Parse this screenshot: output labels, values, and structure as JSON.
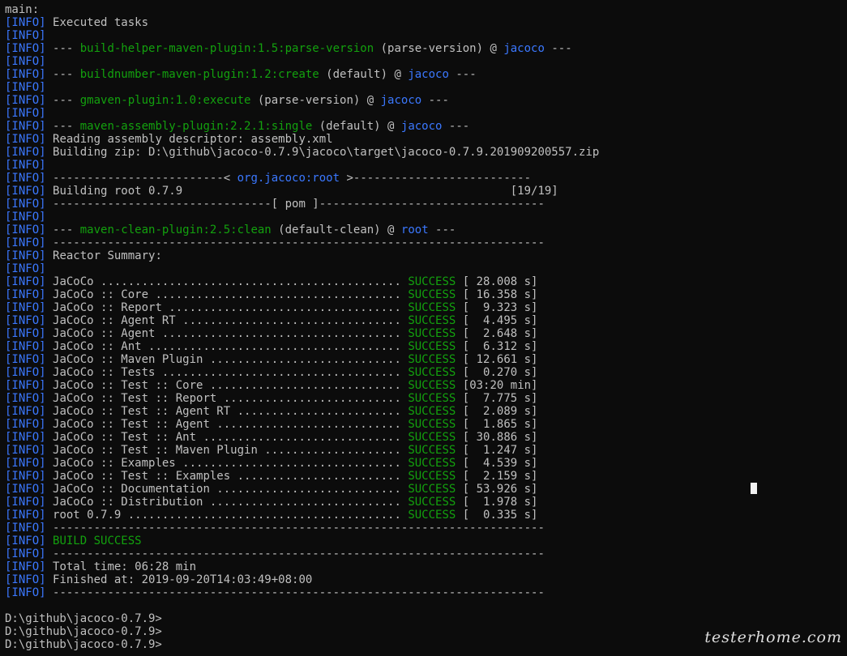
{
  "terminal": {
    "first_line": "main:",
    "info_tag": "[INFO]",
    "executed": "Executed tasks",
    "plugins": [
      {
        "prefix": "--- ",
        "name": "build-helper-maven-plugin:1.5:parse-version",
        "goal": " (parse-version) @ ",
        "project": "jacoco",
        "suffix": " ---"
      },
      {
        "prefix": "--- ",
        "name": "buildnumber-maven-plugin:1.2:create",
        "goal": " (default) @ ",
        "project": "jacoco",
        "suffix": " ---"
      },
      {
        "prefix": "--- ",
        "name": "gmaven-plugin:1.0:execute",
        "goal": " (parse-version) @ ",
        "project": "jacoco",
        "suffix": " ---"
      },
      {
        "prefix": "--- ",
        "name": "maven-assembly-plugin:2.2.1:single",
        "goal": " (default) @ ",
        "project": "jacoco",
        "suffix": " ---"
      }
    ],
    "reading": "Reading assembly descriptor: assembly.xml",
    "building_zip": "Building zip: D:\\github\\jacoco-0.7.9\\jacoco\\target\\jacoco-0.7.9.201909200557.zip",
    "root_header_left": "-------------------------< ",
    "root_header_id": "org.jacoco:root",
    "root_header_right": " >--------------------------",
    "building_root": "Building root 0.7.9                                                [19/19]",
    "pom_line": "--------------------------------[ pom ]---------------------------------",
    "clean_plugin": {
      "prefix": "--- ",
      "name": "maven-clean-plugin:2.5:clean",
      "goal": " (default-clean) @ ",
      "project": "root",
      "suffix": " ---"
    },
    "separator": "------------------------------------------------------------------------",
    "reactor_summary": "Reactor Summary:",
    "reactor_items": [
      {
        "label": "JaCoCo ............................................",
        "status": "SUCCESS",
        "time": " [ 28.008 s]"
      },
      {
        "label": "JaCoCo :: Core ....................................",
        "status": "SUCCESS",
        "time": " [ 16.358 s]"
      },
      {
        "label": "JaCoCo :: Report ..................................",
        "status": "SUCCESS",
        "time": " [  9.323 s]"
      },
      {
        "label": "JaCoCo :: Agent RT ................................",
        "status": "SUCCESS",
        "time": " [  4.495 s]"
      },
      {
        "label": "JaCoCo :: Agent ...................................",
        "status": "SUCCESS",
        "time": " [  2.648 s]"
      },
      {
        "label": "JaCoCo :: Ant .....................................",
        "status": "SUCCESS",
        "time": " [  6.312 s]"
      },
      {
        "label": "JaCoCo :: Maven Plugin ............................",
        "status": "SUCCESS",
        "time": " [ 12.661 s]"
      },
      {
        "label": "JaCoCo :: Tests ...................................",
        "status": "SUCCESS",
        "time": " [  0.270 s]"
      },
      {
        "label": "JaCoCo :: Test :: Core ............................",
        "status": "SUCCESS",
        "time": " [03:20 min]"
      },
      {
        "label": "JaCoCo :: Test :: Report ..........................",
        "status": "SUCCESS",
        "time": " [  7.775 s]"
      },
      {
        "label": "JaCoCo :: Test :: Agent RT ........................",
        "status": "SUCCESS",
        "time": " [  2.089 s]"
      },
      {
        "label": "JaCoCo :: Test :: Agent ...........................",
        "status": "SUCCESS",
        "time": " [  1.865 s]"
      },
      {
        "label": "JaCoCo :: Test :: Ant .............................",
        "status": "SUCCESS",
        "time": " [ 30.886 s]"
      },
      {
        "label": "JaCoCo :: Test :: Maven Plugin ....................",
        "status": "SUCCESS",
        "time": " [  1.247 s]"
      },
      {
        "label": "JaCoCo :: Examples ................................",
        "status": "SUCCESS",
        "time": " [  4.539 s]"
      },
      {
        "label": "JaCoCo :: Test :: Examples ........................",
        "status": "SUCCESS",
        "time": " [  2.159 s]"
      },
      {
        "label": "JaCoCo :: Documentation ...........................",
        "status": "SUCCESS",
        "time": " [ 53.926 s]"
      },
      {
        "label": "JaCoCo :: Distribution ............................",
        "status": "SUCCESS",
        "time": " [  1.978 s]"
      },
      {
        "label": "root 0.7.9 ........................................",
        "status": "SUCCESS",
        "time": " [  0.335 s]"
      }
    ],
    "build_success": "BUILD SUCCESS",
    "total_time": "Total time: 06:28 min",
    "finished_at": "Finished at: 2019-09-20T14:03:49+08:00",
    "prompts": [
      "D:\\github\\jacoco-0.7.9>",
      "D:\\github\\jacoco-0.7.9>",
      "D:\\github\\jacoco-0.7.9>"
    ]
  },
  "watermark": "testerhome.com",
  "colors": {
    "background": "#0c0c0c",
    "text": "#c0c0c0",
    "info_tag": "#3b78ff",
    "plugin_name": "#13a10e",
    "success": "#13a10e"
  }
}
